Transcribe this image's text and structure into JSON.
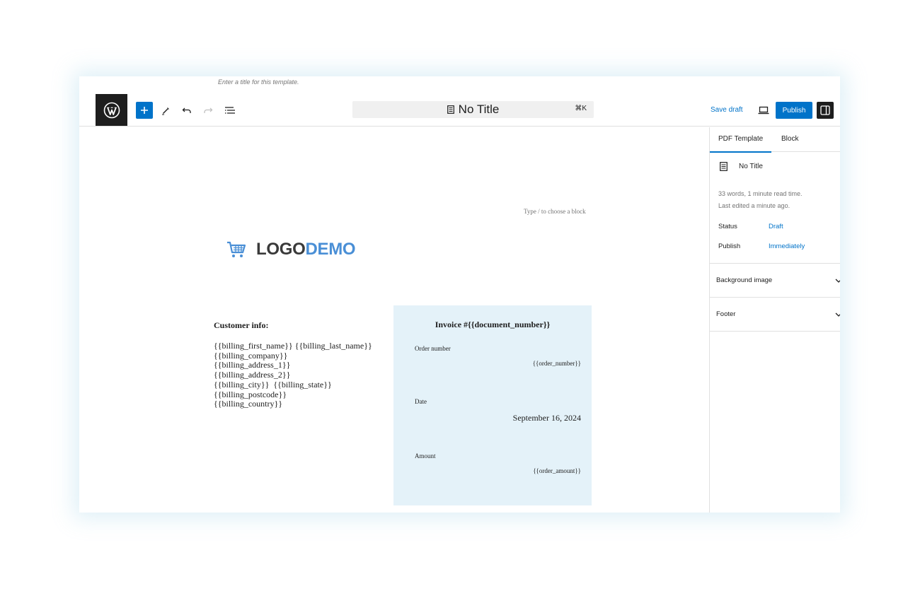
{
  "title_hint": "Enter a title for this template.",
  "toolbar": {
    "document_title": "No Title",
    "shortcut": "⌘K",
    "save_draft": "Save draft",
    "publish": "Publish"
  },
  "canvas": {
    "block_hint": "Type / to choose a block",
    "logo": {
      "part1": "LOGO",
      "part2": "DEMO"
    },
    "customer": {
      "heading": "Customer info:",
      "lines": [
        "{{billing_first_name}} {{billing_last_name}}",
        "{{billing_company}}",
        "{{billing_address_1}}",
        "{{billing_address_2}}",
        "{{billing_city}}  {{billing_state}}",
        "{{billing_postcode}}",
        "{{billing_country}}"
      ]
    },
    "invoice": {
      "title": "Invoice #{{document_number}}",
      "order_label": "Order number",
      "order_value": "{{order_number}}",
      "date_label": "Date",
      "date_value": "September 16, 2024",
      "amount_label": "Amount",
      "amount_value": "{{order_amount}}"
    }
  },
  "sidebar": {
    "tabs": [
      "PDF Template",
      "Block"
    ],
    "doc_title": "No Title",
    "meta_line1": "33 words, 1 minute read time.",
    "meta_line2": "Last edited a minute ago.",
    "status_label": "Status",
    "status_value": "Draft",
    "publish_label": "Publish",
    "publish_value": "Immediately",
    "panels": [
      "Background image",
      "Footer"
    ]
  },
  "colors": {
    "accent": "#0073c9",
    "logo_blue": "#4a8fd6",
    "invoice_bg": "#e4f2f9",
    "dark": "#1e1e1e"
  }
}
